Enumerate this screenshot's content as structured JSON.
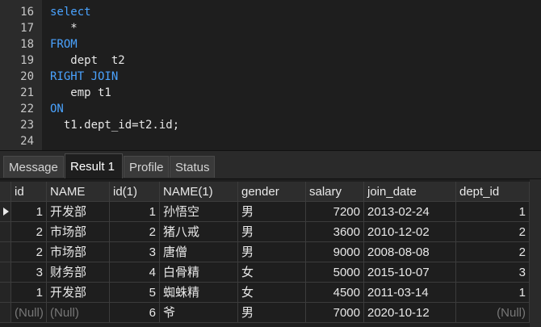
{
  "editor": {
    "lines": [
      {
        "num": "16",
        "text": "select",
        "kw": true
      },
      {
        "num": "17",
        "text": "   *",
        "kw": false
      },
      {
        "num": "18",
        "text": "FROM",
        "kw": true
      },
      {
        "num": "19",
        "text": "   dept  t2",
        "kw": false
      },
      {
        "num": "20",
        "text": "RIGHT JOIN",
        "kw": true
      },
      {
        "num": "21",
        "text": "   emp t1",
        "kw": false
      },
      {
        "num": "22",
        "text": "ON",
        "kw": true
      },
      {
        "num": "23",
        "text": "  t1.dept_id=t2.id;",
        "kw": false
      },
      {
        "num": "24",
        "text": "",
        "kw": false
      }
    ]
  },
  "tabs": [
    {
      "label": "Message",
      "active": false
    },
    {
      "label": "Result 1",
      "active": true
    },
    {
      "label": "Profile",
      "active": false
    },
    {
      "label": "Status",
      "active": false
    }
  ],
  "grid": {
    "columns": [
      "id",
      "NAME",
      "id(1)",
      "NAME(1)",
      "gender",
      "salary",
      "join_date",
      "dept_id"
    ],
    "rows": [
      [
        "1",
        "开发部",
        "1",
        "孙悟空",
        "男",
        "7200",
        "2013-02-24",
        "1"
      ],
      [
        "2",
        "市场部",
        "2",
        "猪八戒",
        "男",
        "3600",
        "2010-12-02",
        "2"
      ],
      [
        "2",
        "市场部",
        "3",
        "唐僧",
        "男",
        "9000",
        "2008-08-08",
        "2"
      ],
      [
        "3",
        "财务部",
        "4",
        "白骨精",
        "女",
        "5000",
        "2015-10-07",
        "3"
      ],
      [
        "1",
        "开发部",
        "5",
        "蜘蛛精",
        "女",
        "4500",
        "2011-03-14",
        "1"
      ],
      [
        "(Null)",
        "(Null)",
        "6",
        "爷",
        "男",
        "7000",
        "2020-10-12",
        "(Null)"
      ]
    ]
  }
}
